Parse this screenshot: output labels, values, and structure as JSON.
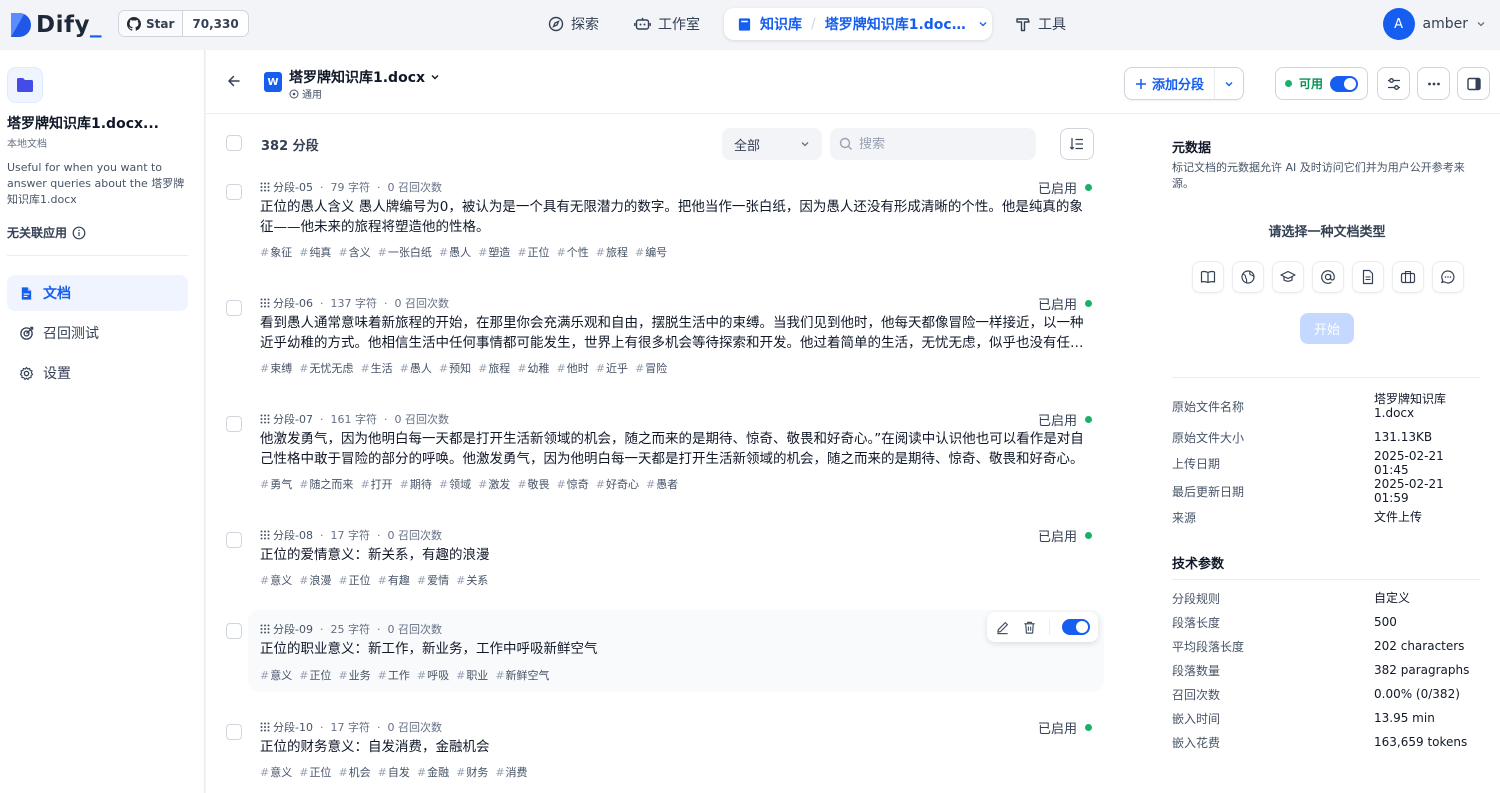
{
  "nav": {
    "brand": "Dify",
    "github_star": "Star",
    "github_count": "70,330",
    "items": [
      {
        "label": "探索",
        "icon": "compass-icon"
      },
      {
        "label": "工作室",
        "icon": "robot-icon"
      },
      {
        "label": "知识库",
        "icon": "book-icon"
      },
      {
        "label": "工具",
        "icon": "hammer-icon"
      }
    ],
    "breadcrumb_doc": "塔罗牌知识库1.docx...",
    "user_initial": "A",
    "user_name": "amber"
  },
  "sidebar": {
    "title": "塔罗牌知识库1.docx...",
    "subtitle": "本地文档",
    "description": "Useful for when you want to answer queries about the 塔罗牌知识库1.docx",
    "no_app": "无关联应用",
    "menu": [
      {
        "label": "文档",
        "active": true
      },
      {
        "label": "召回测试",
        "active": false
      },
      {
        "label": "设置",
        "active": false
      }
    ]
  },
  "document": {
    "name": "塔罗牌知识库1.docx",
    "mode": "通用",
    "add_segment": "添加分段",
    "status_label": "可用"
  },
  "list": {
    "count": "382 分段",
    "filter_value": "全部",
    "search_placeholder": "搜索",
    "segments": [
      {
        "id": "分段-05",
        "chars": "79 字符",
        "recall": "0 召回次数",
        "status": "已启用",
        "text": "正位的愚人含义 愚人牌编号为0，被认为是一个具有无限潜力的数字。把他当作一张白纸，因为愚人还没有形成清晰的个性。他是纯真的象征——他未来的旅程将塑造他的性格。",
        "tags": [
          "象征",
          "纯真",
          "含义",
          "一张白纸",
          "愚人",
          "塑造",
          "正位",
          "个性",
          "旅程",
          "编号"
        ]
      },
      {
        "id": "分段-06",
        "chars": "137 字符",
        "recall": "0 召回次数",
        "status": "已启用",
        "text": "看到愚人通常意味着新旅程的开始，在那里你会充满乐观和自由，摆脱生活中的束缚。当我们见到他时，他每天都像冒险一样接近，以一种近乎幼稚的方式。他相信生活中任何事情都可能发生，世界上有很多机会等待探索和开发。他过着简单的生活，无忧无虑，似乎也没有任何烦恼。",
        "tags": [
          "束缚",
          "无忧无虑",
          "生活",
          "愚人",
          "预知",
          "旅程",
          "幼稚",
          "他时",
          "近乎",
          "冒险"
        ]
      },
      {
        "id": "分段-07",
        "chars": "161 字符",
        "recall": "0 召回次数",
        "status": "已启用",
        "text": "他激发勇气，因为他明白每一天都是打开生活新领域的机会，随之而来的是期待、惊奇、敬畏和好奇心。”在阅读中认识他也可以看作是对自己性格中敢于冒险的部分的呼唤。他激发勇气，因为他明白每一天都是打开生活新领域的机会，随之而来的是期待、惊奇、敬畏和好奇心。",
        "tags": [
          "勇气",
          "随之而来",
          "打开",
          "期待",
          "领域",
          "激发",
          "敬畏",
          "惊奇",
          "好奇心",
          "愚者"
        ]
      },
      {
        "id": "分段-08",
        "chars": "17 字符",
        "recall": "0 召回次数",
        "status": "已启用",
        "text": "正位的爱情意义：新关系，有趣的浪漫",
        "tags": [
          "意义",
          "浪漫",
          "正位",
          "有趣",
          "爱情",
          "关系"
        ]
      },
      {
        "id": "分段-09",
        "chars": "25 字符",
        "recall": "0 召回次数",
        "status": "",
        "text": "正位的职业意义：新工作，新业务，工作中呼吸新鲜空气",
        "tags": [
          "意义",
          "正位",
          "业务",
          "工作",
          "呼吸",
          "职业",
          "新鲜空气"
        ]
      },
      {
        "id": "分段-10",
        "chars": "17 字符",
        "recall": "0 召回次数",
        "status": "已启用",
        "text": "正位的财务意义：自发消费，金融机会",
        "tags": [
          "意义",
          "正位",
          "机会",
          "自发",
          "金融",
          "财务",
          "消费"
        ]
      }
    ]
  },
  "metadata": {
    "title": "元数据",
    "description": "标记文档的元数据允许 AI 及时访问它们并为用户公开参考来源。",
    "choose_type": "请选择一种文档类型",
    "type_icons": [
      "book-open-icon",
      "globe-icon",
      "graduation-cap-icon",
      "at-sign-icon",
      "file-text-icon",
      "briefcase-icon",
      "chat-icon"
    ],
    "start_button": "开始",
    "file_info": [
      {
        "k": "原始文件名称",
        "v": "塔罗牌知识库1.docx"
      },
      {
        "k": "原始文件大小",
        "v": "131.13KB"
      },
      {
        "k": "上传日期",
        "v": "2025-02-21 01:45"
      },
      {
        "k": "最后更新日期",
        "v": "2025-02-21 01:59"
      },
      {
        "k": "来源",
        "v": "文件上传"
      }
    ],
    "tech_title": "技术参数",
    "tech_info": [
      {
        "k": "分段规则",
        "v": "自定义"
      },
      {
        "k": "段落长度",
        "v": "500"
      },
      {
        "k": "平均段落长度",
        "v": "202 characters"
      },
      {
        "k": "段落数量",
        "v": "382 paragraphs"
      },
      {
        "k": "召回次数",
        "v": "0.00% (0/382)"
      },
      {
        "k": "嵌入时间",
        "v": "13.95 min"
      },
      {
        "k": "嵌入花费",
        "v": "163,659 tokens"
      }
    ]
  }
}
